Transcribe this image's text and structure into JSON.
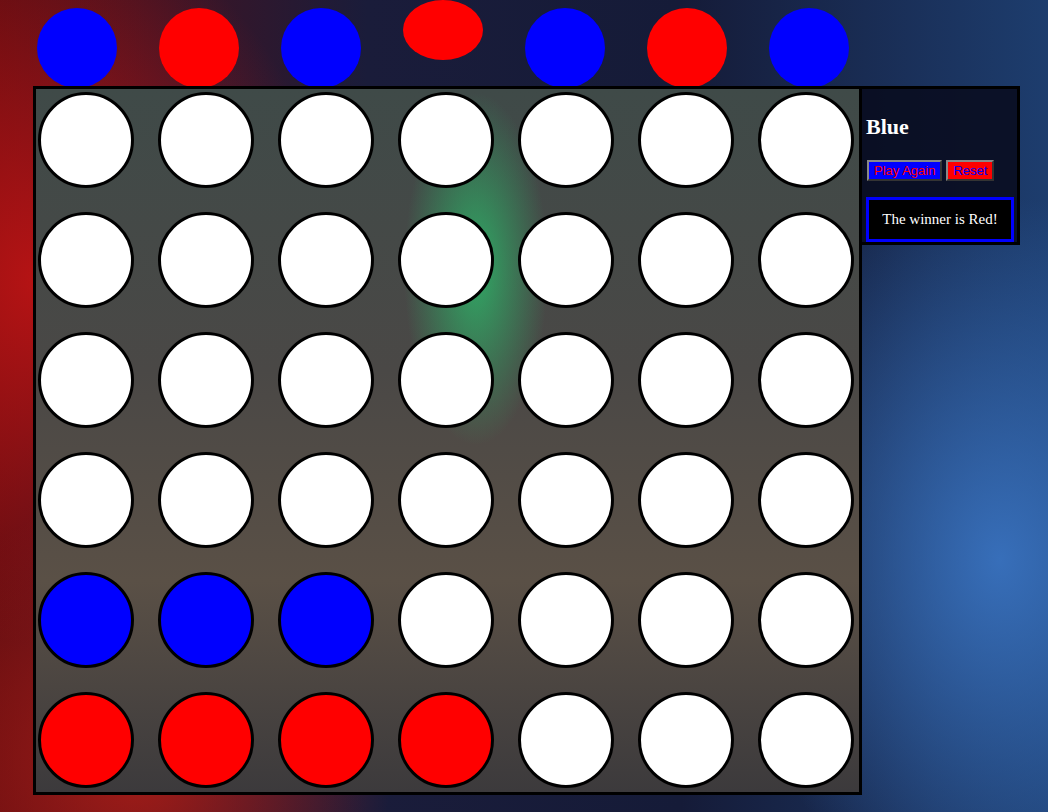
{
  "drop_row": [
    {
      "color": "#0000ff",
      "selected": false
    },
    {
      "color": "#ff0000",
      "selected": false
    },
    {
      "color": "#0000ff",
      "selected": false
    },
    {
      "color": "#ff0000",
      "selected": true
    },
    {
      "color": "#0000ff",
      "selected": false
    },
    {
      "color": "#ff0000",
      "selected": false
    },
    {
      "color": "#0000ff",
      "selected": false
    }
  ],
  "board": {
    "rows": [
      [
        "empty",
        "empty",
        "empty",
        "empty",
        "empty",
        "empty",
        "empty"
      ],
      [
        "empty",
        "empty",
        "empty",
        "empty",
        "empty",
        "empty",
        "empty"
      ],
      [
        "empty",
        "empty",
        "empty",
        "empty",
        "empty",
        "empty",
        "empty"
      ],
      [
        "empty",
        "empty",
        "empty",
        "empty",
        "empty",
        "empty",
        "empty"
      ],
      [
        "blue",
        "blue",
        "blue",
        "empty",
        "empty",
        "empty",
        "empty"
      ],
      [
        "red",
        "red",
        "red",
        "red",
        "empty",
        "empty",
        "empty"
      ]
    ]
  },
  "panel": {
    "turn": "Blue",
    "buttons": [
      {
        "label": "Play Again",
        "color": "#0000ff"
      },
      {
        "label": "Reset",
        "color": "#ff0000"
      }
    ],
    "message": "The winner is Red!"
  }
}
